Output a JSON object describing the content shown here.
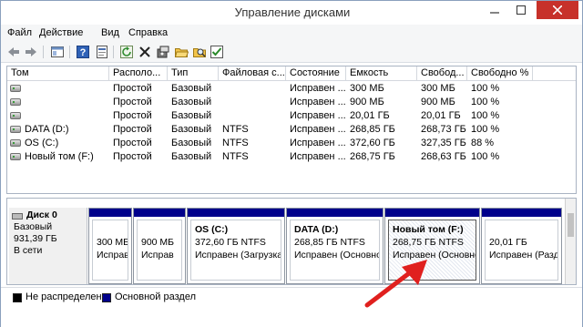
{
  "window": {
    "title": "Управление дисками"
  },
  "menu": [
    "Файл",
    "Действие",
    "Вид",
    "Справка"
  ],
  "toolbar": [
    {
      "name": "back-icon"
    },
    {
      "name": "forward-icon"
    },
    {
      "name": "console-icon"
    },
    {
      "name": "help-icon"
    },
    {
      "name": "properties-icon"
    },
    {
      "name": "refresh-icon"
    },
    {
      "name": "delete-icon"
    },
    {
      "name": "settings-icon"
    },
    {
      "name": "open-folder-icon"
    },
    {
      "name": "find-icon"
    },
    {
      "name": "checklist-icon"
    }
  ],
  "volumes": {
    "columns": [
      "Том",
      "Располо...",
      "Тип",
      "Файловая с...",
      "Состояние",
      "Емкость",
      "Свобод...",
      "Свободно %"
    ],
    "rows": [
      [
        "",
        "Простой",
        "Базовый",
        "",
        "Исправен ...",
        "300 МБ",
        "300 МБ",
        "100 %"
      ],
      [
        "",
        "Простой",
        "Базовый",
        "",
        "Исправен ...",
        "900 МБ",
        "900 МБ",
        "100 %"
      ],
      [
        "",
        "Простой",
        "Базовый",
        "",
        "Исправен ...",
        "20,01 ГБ",
        "20,01 ГБ",
        "100 %"
      ],
      [
        "DATA (D:)",
        "Простой",
        "Базовый",
        "NTFS",
        "Исправен ...",
        "268,85 ГБ",
        "268,73 ГБ",
        "100 %"
      ],
      [
        "OS (C:)",
        "Простой",
        "Базовый",
        "NTFS",
        "Исправен ...",
        "372,60 ГБ",
        "327,35 ГБ",
        "88 %"
      ],
      [
        "Новый том (F:)",
        "Простой",
        "Базовый",
        "NTFS",
        "Исправен ...",
        "268,75 ГБ",
        "268,63 ГБ",
        "100 %"
      ]
    ]
  },
  "disk": {
    "name": "Диск 0",
    "type": "Базовый",
    "size": "931,39 ГБ",
    "status": "В сети",
    "partitions": [
      {
        "name": "",
        "size": "300 МБ",
        "status": "Исправ"
      },
      {
        "name": "",
        "size": "900 МБ",
        "status": "Исправ"
      },
      {
        "name": "OS  (C:)",
        "size": "372,60 ГБ NTFS",
        "status": "Исправен (Загрузка,"
      },
      {
        "name": "DATA  (D:)",
        "size": "268,85 ГБ NTFS",
        "status": "Исправен (Основно"
      },
      {
        "name": "Новый том  (F:)",
        "size": "268,75 ГБ NTFS",
        "status": "Исправен (Основно"
      },
      {
        "name": "",
        "size": "20,01 ГБ",
        "status": "Исправен (Разде"
      }
    ]
  },
  "legend": [
    {
      "label": "Не распределена",
      "color": "#000000"
    },
    {
      "label": "Основной раздел",
      "color": "#00008b"
    }
  ],
  "colors": {
    "primary_partition": "#00008b",
    "unallocated": "#000000",
    "annotation_arrow": "#e0201e"
  }
}
